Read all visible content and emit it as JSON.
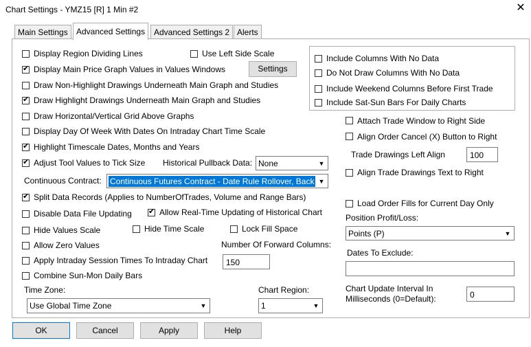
{
  "window": {
    "title": "Chart Settings - YMZ15 [R]  1 Min  #2",
    "close": "✕"
  },
  "tabs": [
    "Main Settings",
    "Advanced Settings",
    "Advanced Settings 2",
    "Alerts"
  ],
  "left": {
    "display_region_dividing_lines": "Display Region Dividing Lines",
    "use_left_side_scale": "Use Left Side Scale",
    "display_main_price_values": "Display Main Price Graph Values in Values Windows",
    "settings_button": "Settings",
    "draw_non_highlight": "Draw Non-Highlight Drawings Underneath Main Graph and Studies",
    "draw_highlight": "Draw Highlight Drawings Underneath Main Graph and Studies",
    "draw_grid_above": "Draw Horizontal/Vertical Grid Above Graphs",
    "display_day_of_week": "Display Day Of Week With Dates On Intraday Chart Time Scale",
    "highlight_timescale": "Highlight Timescale Dates, Months and Years",
    "adjust_tool_values": "Adjust Tool Values to Tick Size",
    "historical_pullback_label": "Historical Pullback Data:",
    "historical_pullback_value": "None",
    "continuous_contract_label": "Continuous Contract:",
    "continuous_contract_value": "Continuous Futures Contract - Date Rule Rollover, Back",
    "split_data_records": "Split Data Records (Applies to NumberOfTrades, Volume and Range Bars)",
    "disable_data_file_updating": "Disable Data File Updating",
    "allow_realtime_updating": "Allow Real-Time Updating of Historical Chart",
    "hide_values_scale": "Hide Values Scale",
    "hide_time_scale": "Hide Time Scale",
    "lock_fill_space": "Lock Fill Space",
    "allow_zero_values": "Allow Zero Values",
    "forward_columns_label": "Number Of Forward Columns:",
    "forward_columns_value": "150",
    "apply_intraday_session": "Apply Intraday Session Times To Intraday Chart",
    "combine_sun_mon": "Combine Sun-Mon Daily Bars",
    "time_zone_label": "Time Zone:",
    "time_zone_value": "Use Global Time Zone",
    "chart_region_label": "Chart Region:",
    "chart_region_value": "1"
  },
  "right": {
    "include_columns_no_data": "Include Columns With No Data",
    "do_not_draw_columns": "Do Not Draw Columns With No Data",
    "include_weekend_columns": "Include Weekend Columns Before First Trade",
    "include_sat_sun_bars": "Include Sat-Sun Bars For Daily Charts",
    "attach_trade_window": "Attach Trade Window to Right Side",
    "align_order_cancel": "Align Order Cancel (X) Button to Right",
    "trade_drawings_left_align_label": "Trade Drawings Left Align",
    "trade_drawings_left_align_value": "100",
    "align_trade_drawings_text": "Align Trade Drawings Text to Right",
    "load_order_fills": "Load Order Fills for Current Day Only",
    "position_pl_label": "Position Profit/Loss:",
    "position_pl_value": "Points (P)",
    "dates_to_exclude_label": "Dates To Exclude:",
    "dates_to_exclude_value": "",
    "update_interval_label_1": "Chart Update Interval In",
    "update_interval_label_2": "Milliseconds (0=Default):",
    "update_interval_value": "0"
  },
  "buttons": {
    "ok": "OK",
    "cancel": "Cancel",
    "apply": "Apply",
    "help": "Help"
  },
  "icons": {
    "dropdown_arrow": "▼"
  }
}
